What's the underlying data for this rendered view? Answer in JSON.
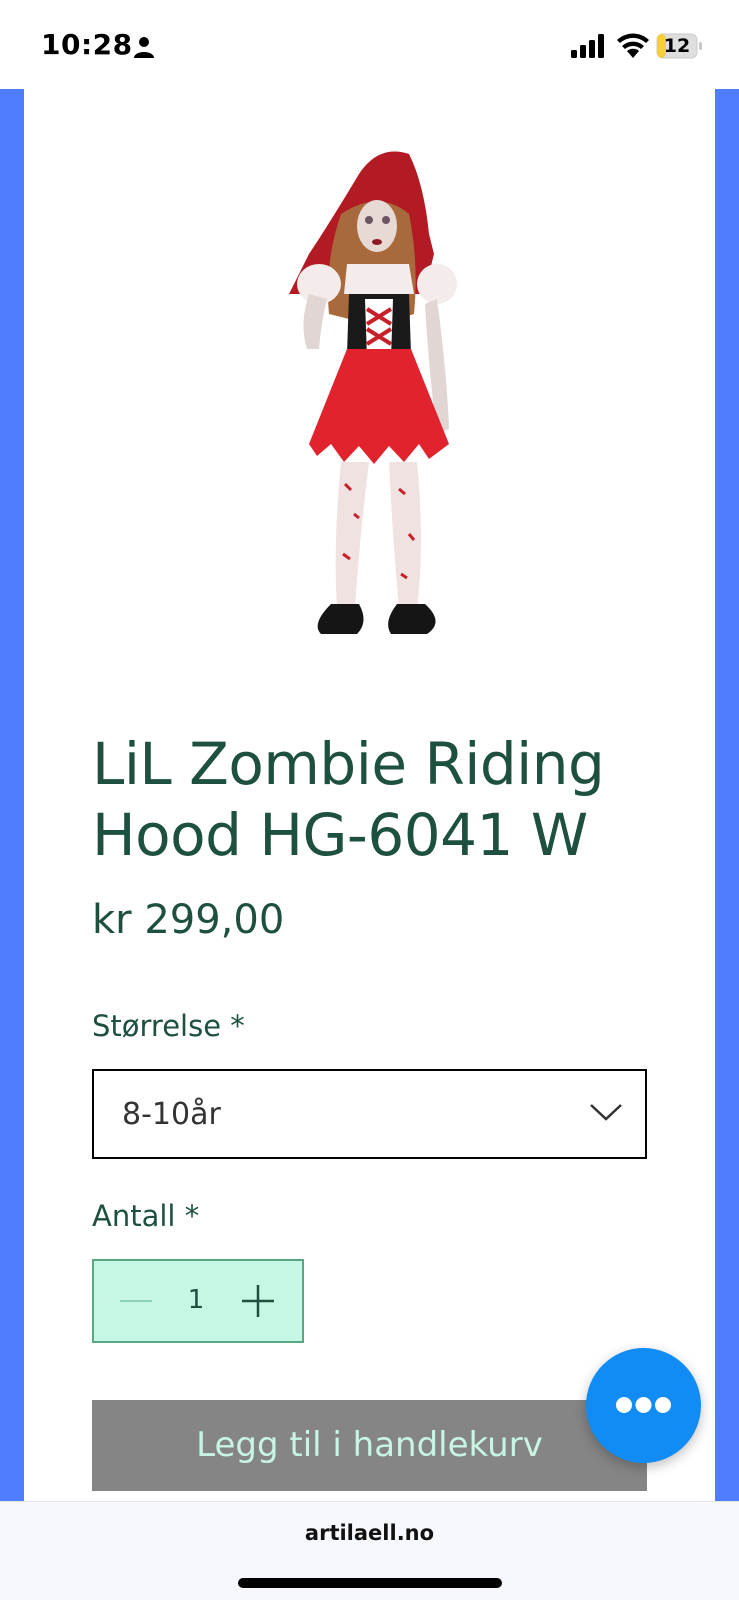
{
  "status_bar": {
    "time": "10:28",
    "battery": "12",
    "icons": [
      "person-icon",
      "signal-icon",
      "wifi-icon",
      "battery-icon"
    ]
  },
  "product": {
    "image_icon": "costume-product-image",
    "title": "LiL Zombie Riding Hood HG-6041 W",
    "price": "kr 299,00"
  },
  "options": {
    "size_label": "Størrelse *",
    "size_value": "8-10år",
    "quantity_label": "Antall *",
    "quantity_value": "1"
  },
  "actions": {
    "add_to_cart_label": "Legg til i handlekurv",
    "chat_icon": "more-icon"
  },
  "browser": {
    "url": "artilaell.no"
  },
  "colors": {
    "frame_blue": "#4f7dfc",
    "text_green": "#1e5040",
    "stepper_bg": "#c5f7e4",
    "button_gray": "#858585",
    "fab_blue": "#118cf5"
  }
}
